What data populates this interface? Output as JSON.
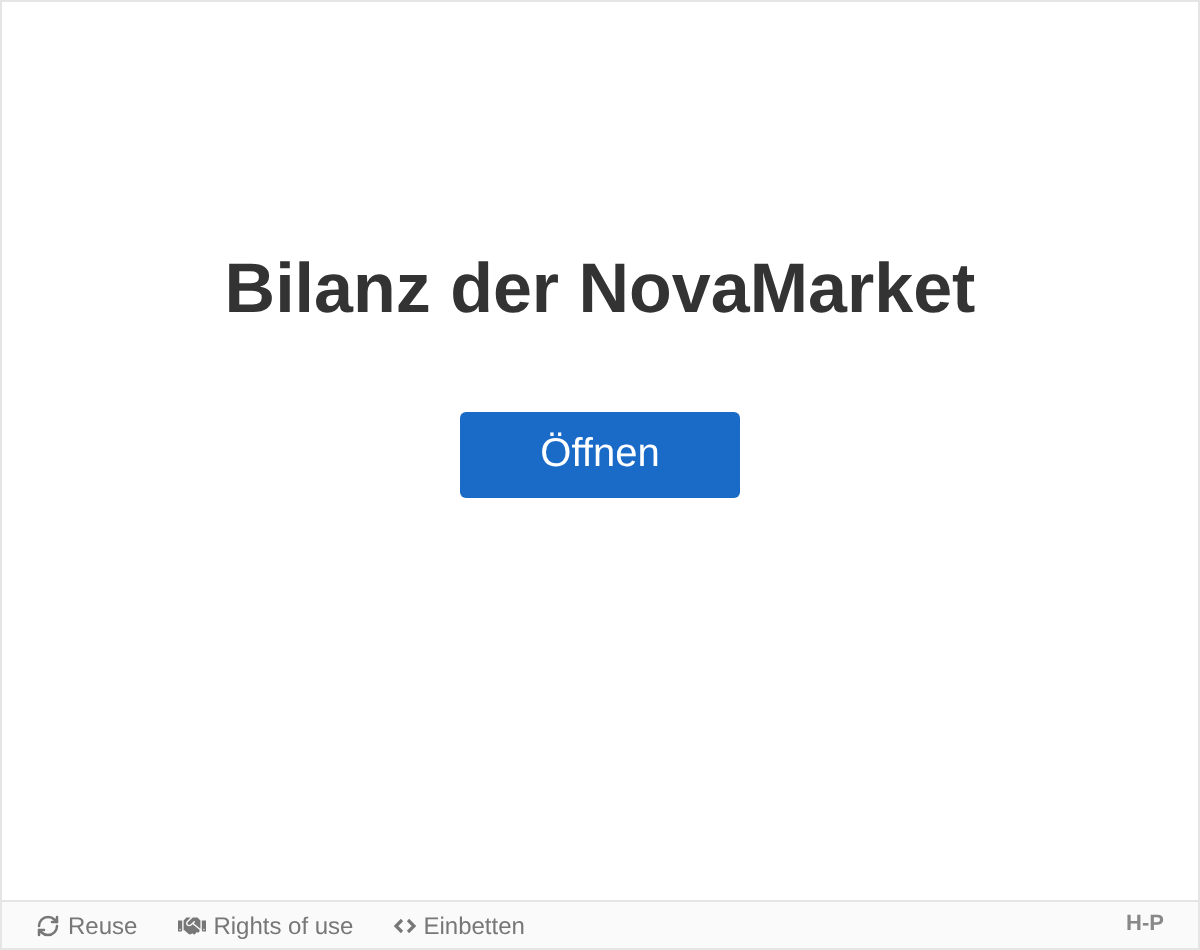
{
  "title": "Bilanz der NovaMarket",
  "open_button": "Öffnen",
  "footer": {
    "actions": [
      {
        "kind": "reuse",
        "label": "Reuse"
      },
      {
        "kind": "rights",
        "label": "Rights of use"
      },
      {
        "kind": "embed",
        "label": "Einbetten"
      }
    ],
    "logo": "H-P"
  }
}
